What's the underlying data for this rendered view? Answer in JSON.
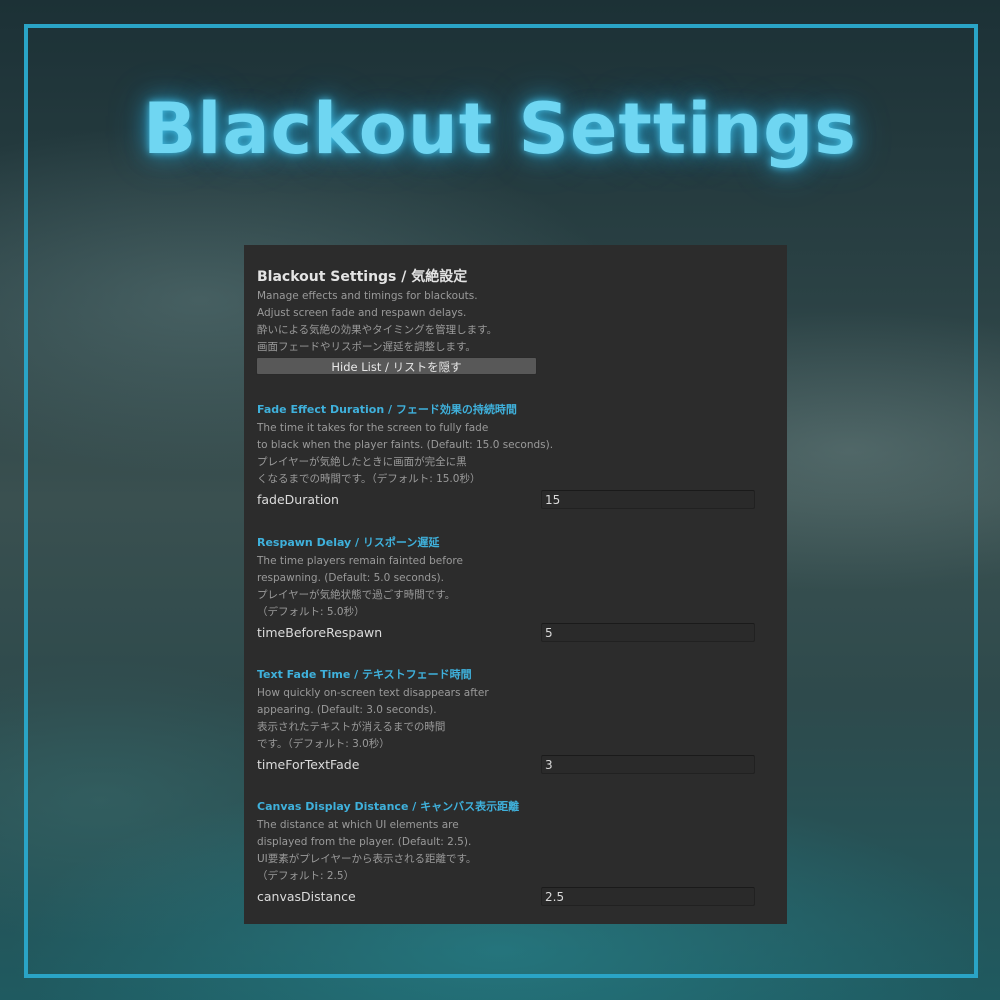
{
  "hero": {
    "title": "Blackout Settings"
  },
  "panel": {
    "title": "Blackout Settings / 気絶設定",
    "description": [
      "Manage effects and timings for blackouts.",
      "Adjust screen fade and respawn delays.",
      "酔いによる気絶の効果やタイミングを管理します。",
      "画面フェードやリスポーン遅延を調整します。"
    ],
    "hide_button": "Hide List / リストを隠す"
  },
  "sections": [
    {
      "heading": "Fade Effect Duration / フェード効果の持続時間",
      "lines": [
        "The time it takes for the screen to fully fade",
        "to black when the player faints. (Default: 15.0 seconds).",
        "プレイヤーが気絶したときに画面が完全に黒",
        "くなるまでの時間です。（デフォルト: 15.0秒）"
      ],
      "field_label": "fadeDuration",
      "field_value": "15"
    },
    {
      "heading": "Respawn Delay / リスポーン遅延",
      "lines": [
        "The time players remain fainted before",
        "respawning. (Default: 5.0 seconds).",
        "プレイヤーが気絶状態で過ごす時間です。",
        "（デフォルト: 5.0秒）"
      ],
      "field_label": "timeBeforeRespawn",
      "field_value": "5"
    },
    {
      "heading": "Text Fade Time / テキストフェード時間",
      "lines": [
        "How quickly on-screen text disappears after",
        "appearing. (Default: 3.0 seconds).",
        "表示されたテキストが消えるまでの時間",
        "です。（デフォルト: 3.0秒）"
      ],
      "field_label": "timeForTextFade",
      "field_value": "3"
    },
    {
      "heading": "Canvas Display Distance / キャンバス表示距離",
      "lines": [
        "The distance at which UI elements are",
        "displayed from the player. (Default: 2.5).",
        "UI要素がプレイヤーから表示される距離です。",
        "（デフォルト: 2.5）"
      ],
      "field_label": "canvasDistance",
      "field_value": "2.5"
    }
  ]
}
